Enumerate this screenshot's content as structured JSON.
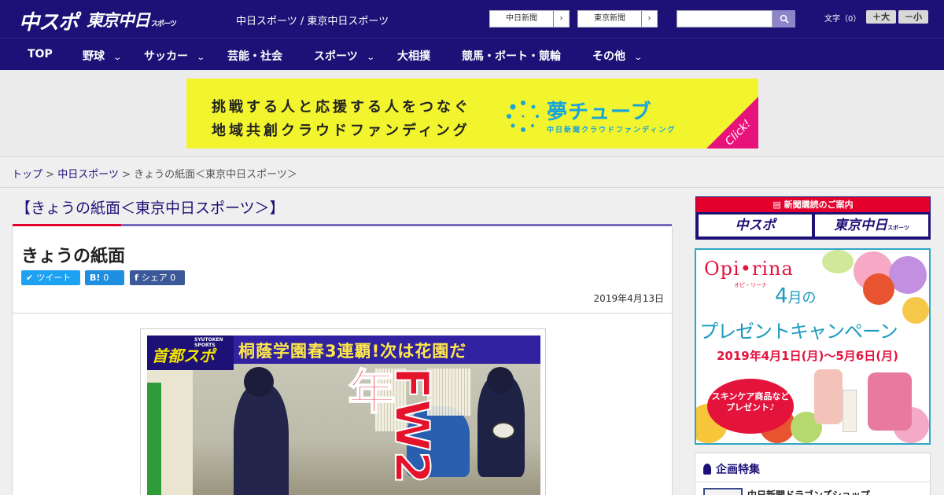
{
  "header": {
    "logo_chuspo": "中スポ",
    "logo_tokyo": "東京中日",
    "logo_tokyo_small": "スポーツ",
    "site_link": "中日スポーツ / 東京中日スポーツ",
    "paper_buttons": [
      {
        "label": "中日新聞",
        "arrow": "›"
      },
      {
        "label": "東京新聞",
        "arrow": "›"
      }
    ],
    "search": {
      "placeholder": "",
      "icon": "search-icon"
    },
    "font_size": {
      "label": "文字（0）",
      "bigger": "＋大",
      "smaller": "－小"
    }
  },
  "nav": {
    "items": [
      {
        "label": "TOP",
        "has_dropdown": false
      },
      {
        "label": "野球",
        "has_dropdown": true
      },
      {
        "label": "サッカー",
        "has_dropdown": true
      },
      {
        "label": "芸能・社会",
        "has_dropdown": false
      },
      {
        "label": "スポーツ",
        "has_dropdown": true
      },
      {
        "label": "大相撲",
        "has_dropdown": false
      },
      {
        "label": "競馬・ボート・競輪",
        "has_dropdown": false
      },
      {
        "label": "その他",
        "has_dropdown": true
      }
    ],
    "chevron": "chevron-down-icon"
  },
  "banner": {
    "line1": "挑戦する人と応援する人をつなぐ",
    "line2": "地域共創クラウドファンディング",
    "title": "夢チューブ",
    "subtitle": "中日新聞クラウドファンディング",
    "click": "Click!",
    "colors": {
      "bg": "#f2f52d",
      "accent": "#1aa4d8",
      "corner": "#e8137a"
    }
  },
  "breadcrumb": {
    "items": [
      {
        "label": "トップ",
        "link": true
      },
      {
        "label": "中日スポーツ",
        "link": true
      },
      {
        "label": "きょうの紙面＜東京中日スポーツ＞",
        "link": false
      }
    ],
    "separator": ">"
  },
  "main": {
    "section_title": "【きょうの紙面＜東京中日スポーツ＞】",
    "article_title": "きょうの紙面",
    "share": {
      "tweet": {
        "icon": "twitter-icon",
        "label": "ツイート"
      },
      "hatena": {
        "icon": "hatena-icon",
        "label": "B!",
        "count": "0"
      },
      "facebook": {
        "icon": "facebook-icon",
        "label": "シェア",
        "count": "0"
      }
    },
    "date": "2019年4月13日",
    "newspaper": {
      "logo": "首都スポ",
      "logo_small": "SYUTOKEN SPORTS",
      "headline": "桐蔭学園春3連覇!次は花園だ",
      "big_text": "FW2年"
    }
  },
  "sidebar": {
    "subscription": {
      "heading": "新聞購読のご案内",
      "chuspo": "中スポ",
      "tokyo": "東京中日",
      "tokyo_small": "スポーツ"
    },
    "ad": {
      "brand": "Opi•rina",
      "brand_sub": "オピ・リーナ",
      "month": "4",
      "month_suffix": "月の",
      "campaign": "プレゼントキャンペーン",
      "dates": "2019年4月1日(月)〜5月6日(月)",
      "badge": "スキンケア商品など プレゼント♪"
    },
    "feature": {
      "title": "企画特集",
      "item": "中日新聞ドラゴンズショップ"
    }
  }
}
